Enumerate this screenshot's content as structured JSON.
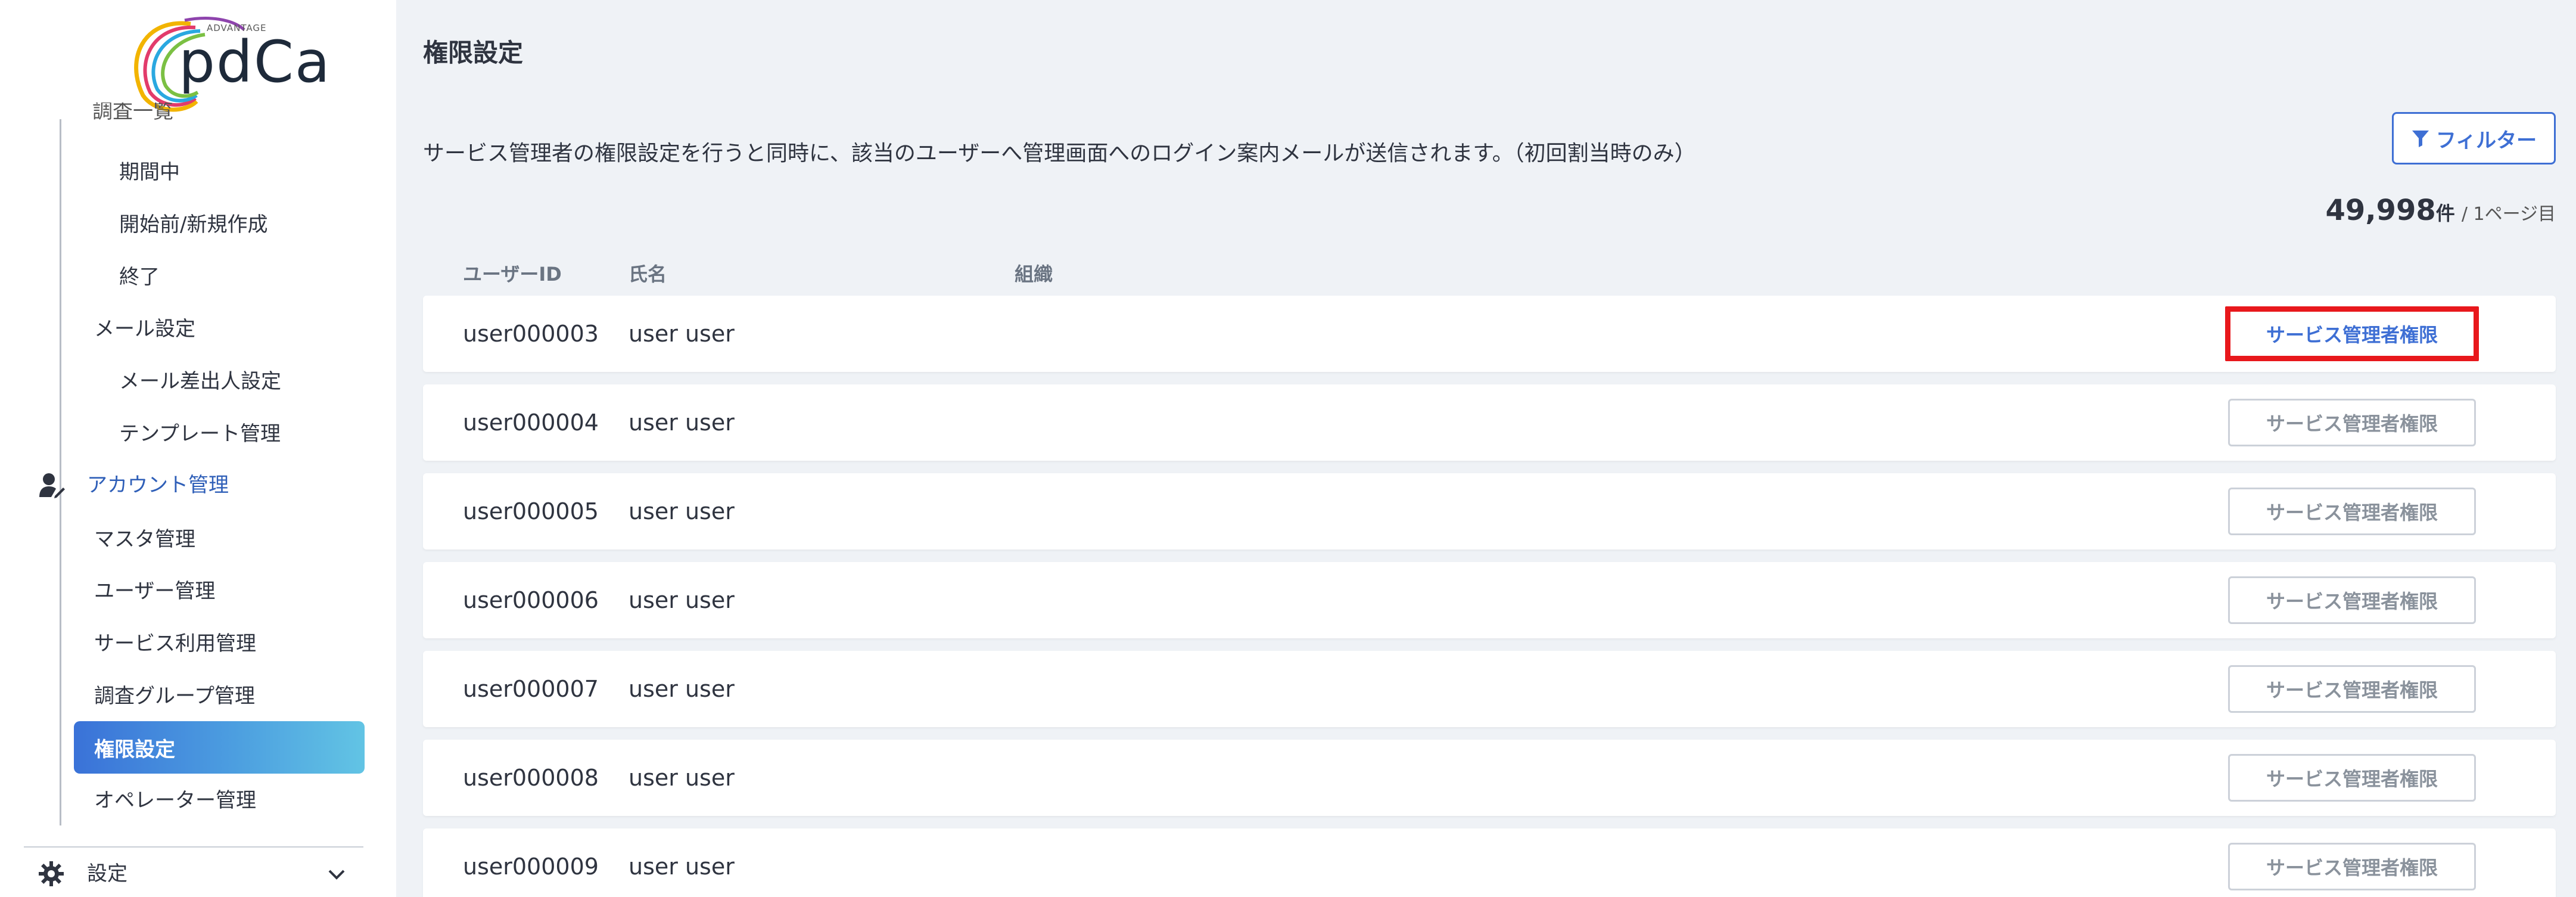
{
  "logo": {
    "superscript": "ADVANTAGE",
    "text": "pdCa"
  },
  "sidebar": {
    "clipped_item": "調査一覧",
    "items": [
      {
        "label": "期間中"
      },
      {
        "label": "開始前/新規作成"
      },
      {
        "label": "終了"
      },
      {
        "label": "メール設定"
      },
      {
        "label": "メール差出人設定"
      },
      {
        "label": "テンプレート管理"
      }
    ],
    "account_section": {
      "label": "アカウント管理",
      "icon": "user-edit-icon"
    },
    "account_items": [
      {
        "label": "マスタ管理"
      },
      {
        "label": "ユーザー管理"
      },
      {
        "label": "サービス利用管理"
      },
      {
        "label": "調査グループ管理"
      },
      {
        "label": "権限設定"
      },
      {
        "label": "オペレーター管理"
      }
    ],
    "settings_section": {
      "label": "設定",
      "icon": "gear-icon"
    }
  },
  "main": {
    "title": "権限設定",
    "description": "サービス管理者の権限設定を行うと同時に、該当のユーザーへ管理画面へのログイン案内メールが送信されます。（初回割当時のみ）",
    "filter_label": "フィルター",
    "count": "49,998",
    "count_unit": "件",
    "page_info": "/ 1ページ目",
    "columns": {
      "user_id": "ユーザーID",
      "name": "氏名",
      "org": "組織"
    },
    "rows": [
      {
        "user_id": "user000003",
        "name": "user user",
        "button": "サービス管理者権限"
      },
      {
        "user_id": "user000004",
        "name": "user user",
        "button": "サービス管理者権限"
      },
      {
        "user_id": "user000005",
        "name": "user user",
        "button": "サービス管理者権限"
      },
      {
        "user_id": "user000006",
        "name": "user user",
        "button": "サービス管理者権限"
      },
      {
        "user_id": "user000007",
        "name": "user user",
        "button": "サービス管理者権限"
      },
      {
        "user_id": "user000008",
        "name": "user user",
        "button": "サービス管理者権限"
      },
      {
        "user_id": "user000009",
        "name": "user user",
        "button": "サービス管理者権限"
      }
    ]
  },
  "colors": {
    "accent": "#3e6fd4",
    "highlight": "#e8181c",
    "active_gradient_start": "#3a72d8",
    "active_gradient_end": "#62c4e4"
  }
}
